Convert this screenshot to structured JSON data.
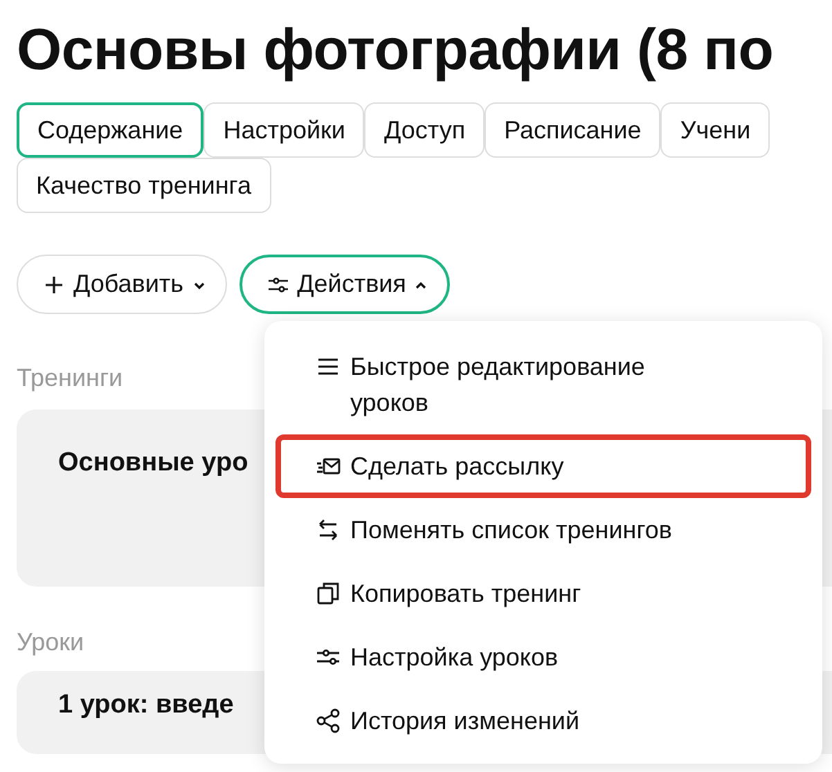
{
  "title": "Основы фотографии (8 по",
  "tabs": [
    {
      "label": "Содержание",
      "selected": true
    },
    {
      "label": "Настройки",
      "selected": false
    },
    {
      "label": "Доступ",
      "selected": false
    },
    {
      "label": "Расписание",
      "selected": false
    },
    {
      "label": "Учени",
      "selected": false
    },
    {
      "label": "Качество тренинга",
      "selected": false
    }
  ],
  "toolbar": [
    {
      "kind": "add",
      "label": "Добавить",
      "expanded": false
    },
    {
      "kind": "actions",
      "label": "Действия",
      "expanded": true
    }
  ],
  "actions_menu": [
    {
      "kind": "lines",
      "label": "Быстрое редактирование уроков",
      "highlighted": false
    },
    {
      "kind": "mail",
      "label": "Сделать рассылку",
      "highlighted": true
    },
    {
      "kind": "swap",
      "label": "Поменять список тренингов",
      "highlighted": false
    },
    {
      "kind": "copy",
      "label": "Копировать тренинг",
      "highlighted": false
    },
    {
      "kind": "sliders",
      "label": "Настройка уроков",
      "highlighted": false
    },
    {
      "kind": "share",
      "label": "История изменений",
      "highlighted": false
    }
  ],
  "sections": [
    {
      "heading": "Тренинги",
      "card_title": "Основные уро"
    },
    {
      "heading": "Уроки",
      "card_title": "1 урок: введе"
    }
  ]
}
